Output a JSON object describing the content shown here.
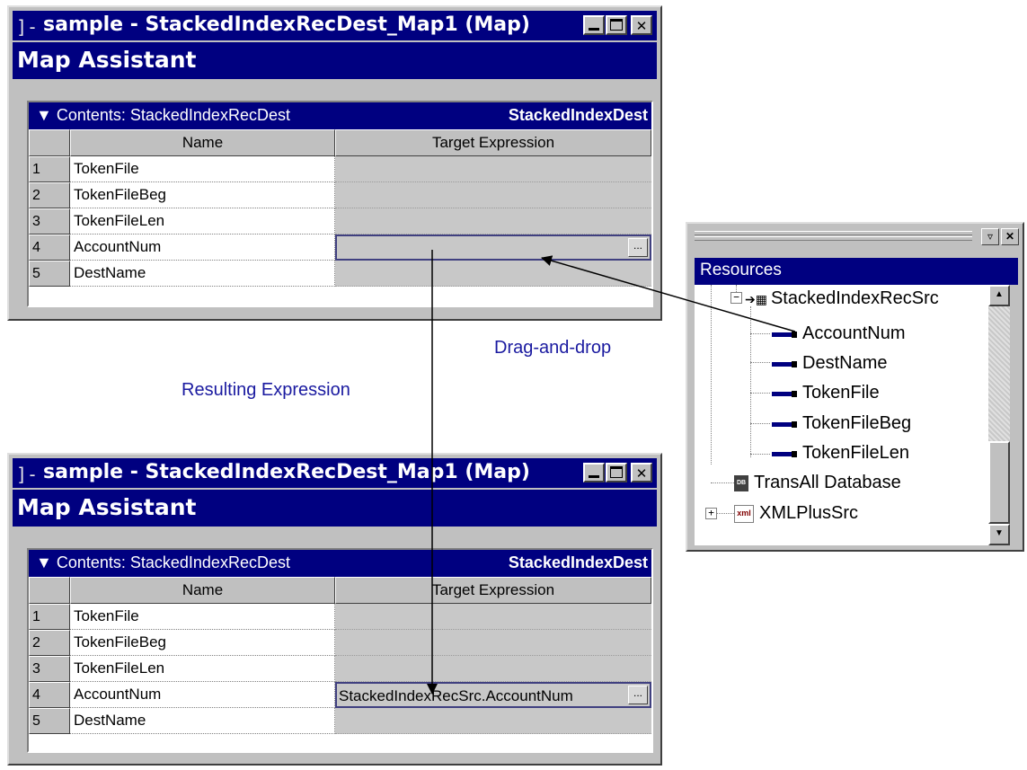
{
  "window_title": "sample - StackedIndexRecDest_Map1 (Map)",
  "header": "Map Assistant",
  "contents_label": "Contents: StackedIndexRecDest",
  "contents_type": "StackedIndexDest",
  "columns": {
    "name": "Name",
    "target": "Target Expression"
  },
  "ellipsis": "...",
  "before": {
    "rows": [
      {
        "num": "1",
        "name": "TokenFile",
        "target": ""
      },
      {
        "num": "2",
        "name": "TokenFileBeg",
        "target": ""
      },
      {
        "num": "3",
        "name": "TokenFileLen",
        "target": ""
      },
      {
        "num": "4",
        "name": "AccountNum",
        "target": ""
      },
      {
        "num": "5",
        "name": "DestName",
        "target": ""
      }
    ]
  },
  "after": {
    "rows": [
      {
        "num": "1",
        "name": "TokenFile",
        "target": ""
      },
      {
        "num": "2",
        "name": "TokenFileBeg",
        "target": ""
      },
      {
        "num": "3",
        "name": "TokenFileLen",
        "target": ""
      },
      {
        "num": "4",
        "name": "AccountNum",
        "target": "StackedIndexRecSrc.AccountNum"
      },
      {
        "num": "5",
        "name": "DestName",
        "target": ""
      }
    ]
  },
  "resources": {
    "title": "Resources",
    "record": "StackedIndexRecSrc",
    "fields": [
      "AccountNum",
      "DestName",
      "TokenFile",
      "TokenFileBeg",
      "TokenFileLen"
    ],
    "database": "TransAll Database",
    "xml": "XMLPlusSrc",
    "db_icon_text": "DB",
    "xml_icon_text": "xml"
  },
  "annotations": {
    "drag": "Drag-and-drop",
    "result": "Resulting Expression"
  },
  "colors": {
    "title_blue": "#000080",
    "annotation_blue": "#1a1aa0",
    "grey": "#c0c0c0"
  }
}
